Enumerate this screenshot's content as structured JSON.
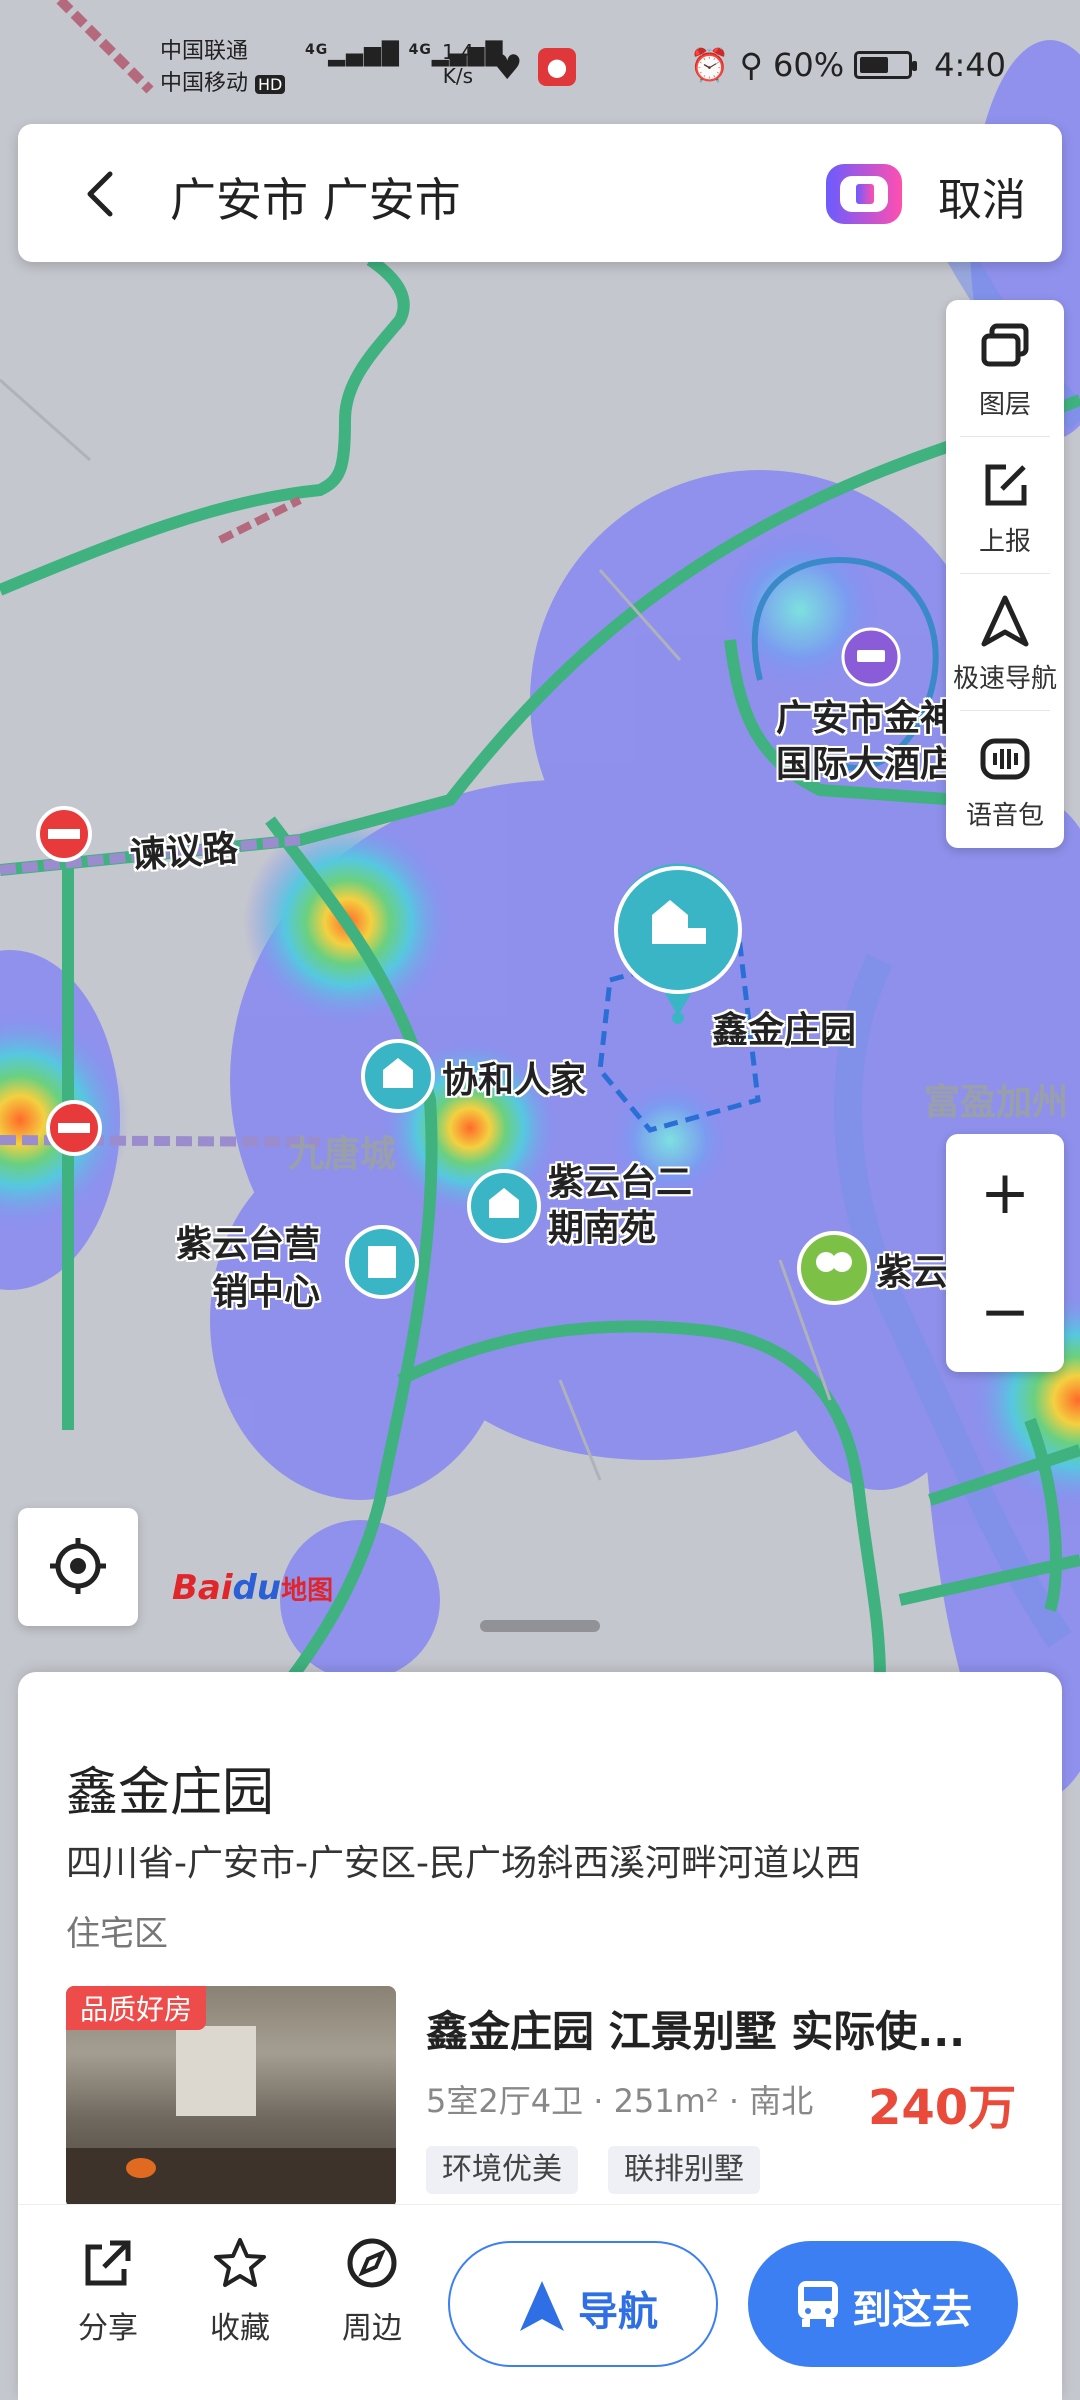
{
  "status_bar": {
    "carrier1": "中国联通",
    "carrier2": "中国移动",
    "hd": "HD",
    "signal1": "4G",
    "signal2": "4G",
    "speed_value": "1.4",
    "speed_unit": "K/s",
    "battery": "60%",
    "time": "4:40",
    "battery_level": 0.6
  },
  "search": {
    "title": "广安市 广安市",
    "cancel_label": "取消"
  },
  "tools": [
    {
      "label": "图层",
      "icon": "layers-icon"
    },
    {
      "label": "上报",
      "icon": "report-icon"
    },
    {
      "label": "极速导航",
      "icon": "fast-nav-icon"
    },
    {
      "label": "语音包",
      "icon": "voice-pack-icon"
    }
  ],
  "zoom": {
    "in": "+",
    "out": "−"
  },
  "map_labels": {
    "road": "谏议路",
    "hotel1": "广安市金神",
    "hotel2": "国际大酒店",
    "selected": "鑫金庄园",
    "xiehe": "协和人家",
    "jiutang": "九唐城",
    "ziyun2_1": "紫云台二",
    "ziyun2_2": "期南苑",
    "ziyunsale_1": "紫云台营",
    "ziyunsale_2": "销中心",
    "park": "紫云",
    "fuying": "富盈加州"
  },
  "logo": {
    "text": "Bai",
    "paw": "du",
    "cn": "地图"
  },
  "place": {
    "name": "鑫金庄园",
    "address": "四川省-广安市-广安区-民广场斜西溪河畔河道以西",
    "type": "住宅区"
  },
  "listing": {
    "badge": "品质好房",
    "title": "鑫金庄园 江景别墅 实际使...",
    "spec": "5室2厅4卫 · 251m² · 南北",
    "price": "240万",
    "tags": [
      "环境优美",
      "联排别墅"
    ]
  },
  "actions": {
    "share": "分享",
    "favorite": "收藏",
    "nearby": "周边",
    "navigate": "导航",
    "go_there": "到这去"
  },
  "colors": {
    "accent": "#3b7ff3",
    "price": "#ea4a3a",
    "badge": "#ee4b4b",
    "road_green": "#3fb27f",
    "heat_blue": "#7b7ff0"
  }
}
